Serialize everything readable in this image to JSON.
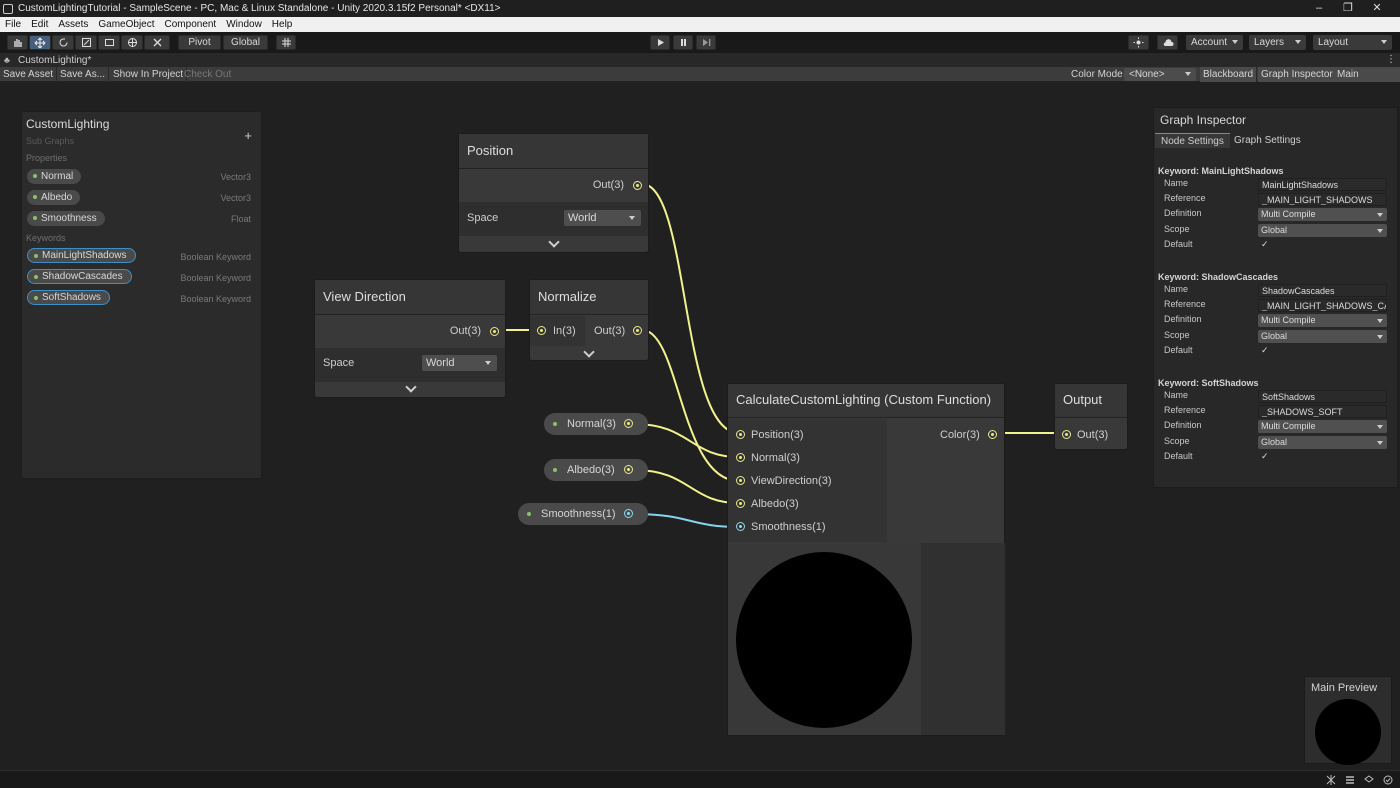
{
  "window": {
    "title": "CustomLightingTutorial - SampleScene - PC, Mac & Linux Standalone - Unity 2020.3.15f2 Personal* <DX11>",
    "controls": {
      "minimize": "–",
      "maximize": "❐",
      "close": "✕"
    }
  },
  "menu": [
    "File",
    "Edit",
    "Assets",
    "GameObject",
    "Component",
    "Window",
    "Help"
  ],
  "toolbar": {
    "pivot": "Pivot",
    "global": "Global",
    "account": "Account",
    "layers": "Layers",
    "layout": "Layout"
  },
  "tab": {
    "title": "CustomLighting*",
    "more": "⋮"
  },
  "graphbar": {
    "save_asset": "Save Asset",
    "save_as": "Save As...",
    "show_in_project": "Show In Project",
    "check_out": "Check Out",
    "color_mode_label": "Color Mode",
    "color_mode_value": "<None>",
    "blackboard": "Blackboard",
    "graph_inspector": "Graph Inspector",
    "main_preview": "Main Preview"
  },
  "blackboard": {
    "title": "CustomLighting",
    "subtitle": "Sub Graphs",
    "add": "+",
    "properties_label": "Properties",
    "properties": [
      {
        "name": "Normal",
        "type": "Vector3"
      },
      {
        "name": "Albedo",
        "type": "Vector3"
      },
      {
        "name": "Smoothness",
        "type": "Float"
      }
    ],
    "keywords_label": "Keywords",
    "keywords": [
      {
        "name": "MainLightShadows",
        "type": "Boolean Keyword"
      },
      {
        "name": "ShadowCascades",
        "type": "Boolean Keyword"
      },
      {
        "name": "SoftShadows",
        "type": "Boolean Keyword"
      }
    ]
  },
  "nodes": {
    "position": {
      "title": "Position",
      "out": "Out(3)",
      "space_label": "Space",
      "space_value": "World"
    },
    "view_direction": {
      "title": "View Direction",
      "out": "Out(3)",
      "space_label": "Space",
      "space_value": "World"
    },
    "normalize": {
      "title": "Normalize",
      "in": "In(3)",
      "out": "Out(3)"
    },
    "custom_function": {
      "title": "CalculateCustomLighting (Custom Function)",
      "inputs": [
        "Position(3)",
        "Normal(3)",
        "ViewDirection(3)",
        "Albedo(3)",
        "Smoothness(1)"
      ],
      "output": "Color(3)"
    },
    "output": {
      "title": "Output",
      "in": "Out(3)"
    }
  },
  "property_nodes": {
    "normal": "Normal(3)",
    "albedo": "Albedo(3)",
    "smoothness": "Smoothness(1)"
  },
  "inspector": {
    "title": "Graph Inspector",
    "tabs": [
      "Node Settings",
      "Graph Settings"
    ],
    "keywords": [
      {
        "header": "Keyword: MainLightShadows",
        "name": "MainLightShadows",
        "reference": "_MAIN_LIGHT_SHADOWS",
        "definition": "Multi Compile",
        "scope": "Global",
        "default": "✓"
      },
      {
        "header": "Keyword: ShadowCascades",
        "name": "ShadowCascades",
        "reference": "_MAIN_LIGHT_SHADOWS_CA",
        "definition": "Multi Compile",
        "scope": "Global",
        "default": "✓"
      },
      {
        "header": "Keyword: SoftShadows",
        "name": "SoftShadows",
        "reference": "_SHADOWS_SOFT",
        "definition": "Multi Compile",
        "scope": "Global",
        "default": "✓"
      }
    ],
    "field_labels": {
      "name": "Name",
      "reference": "Reference",
      "definition": "Definition",
      "scope": "Scope",
      "default": "Default"
    }
  },
  "main_preview": {
    "title": "Main Preview"
  },
  "colors": {
    "wire_vector3": "#f2f28c",
    "wire_float": "#84d4ee",
    "selection": "#3d8fc8",
    "accent": "#5a8fd0"
  }
}
